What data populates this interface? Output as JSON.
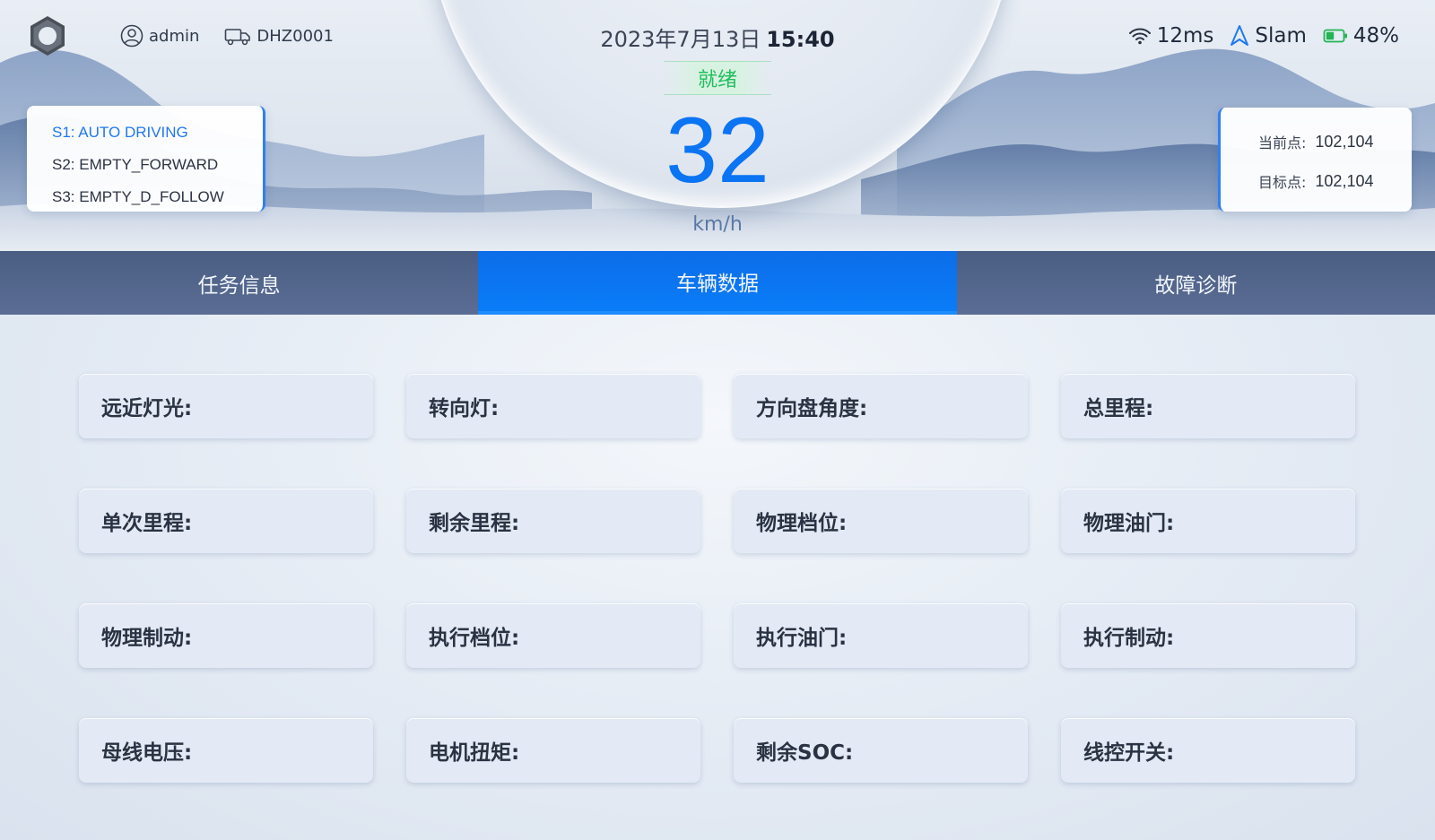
{
  "header": {
    "user": "admin",
    "vehicle_id": "DHZ0001",
    "date": "2023年7月13日",
    "time": "15:40",
    "status": "就绪",
    "speed": "32",
    "speed_unit": "km/h",
    "latency": "12ms",
    "nav_mode": "Slam",
    "battery": "48%",
    "battery_level": 0.48,
    "colors": {
      "accent": "#0b74f2",
      "ready": "#1fbf5b"
    }
  },
  "modes": [
    {
      "label": "S1: AUTO DRIVING",
      "active": true
    },
    {
      "label": "S2: EMPTY_FORWARD",
      "active": false
    },
    {
      "label": "S3: EMPTY_D_FOLLOW",
      "active": false
    }
  ],
  "points": {
    "current_label": "当前点:",
    "current_value": "102,104",
    "target_label": "目标点:",
    "target_value": "102,104"
  },
  "tabs": [
    {
      "label": "任务信息",
      "active": false
    },
    {
      "label": "车辆数据",
      "active": true
    },
    {
      "label": "故障诊断",
      "active": false
    }
  ],
  "fields": [
    "远近灯光:",
    "转向灯:",
    "方向盘角度:",
    "总里程:",
    "单次里程:",
    "剩余里程:",
    "物理档位:",
    "物理油门:",
    "物理制动:",
    "执行档位:",
    "执行油门:",
    "执行制动:",
    "母线电压:",
    "电机扭矩:",
    "剩余SOC:",
    "线控开关:"
  ],
  "icons": {
    "logo": "hexagon-nut-icon",
    "user": "user-circle-icon",
    "vehicle": "truck-icon",
    "wifi": "wifi-icon",
    "nav": "navigation-arrow-icon",
    "battery": "battery-icon"
  }
}
